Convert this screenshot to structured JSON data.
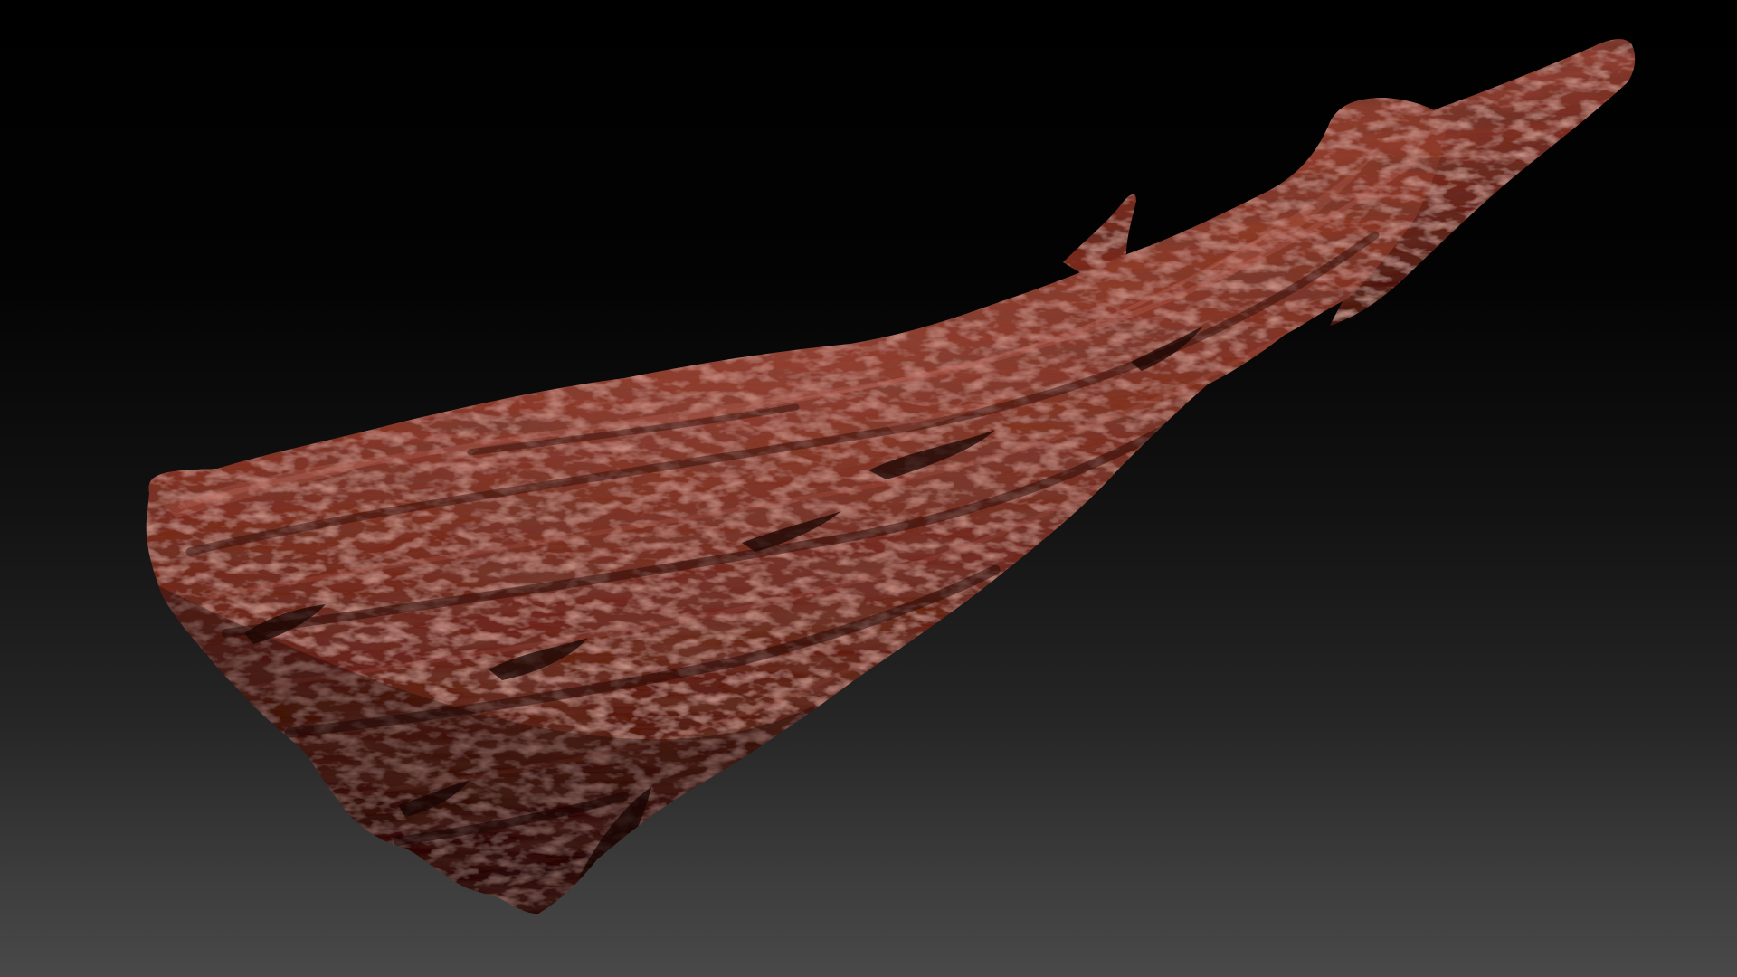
{
  "scene": {
    "subject": "driftwood-sculpt",
    "background_gradient": [
      "#000000",
      "#494949"
    ],
    "material_colors": {
      "highlight": "#b05a4c",
      "mid": "#7a2a20",
      "shadow": "#3a0f0a",
      "deep": "#1c0604"
    }
  }
}
